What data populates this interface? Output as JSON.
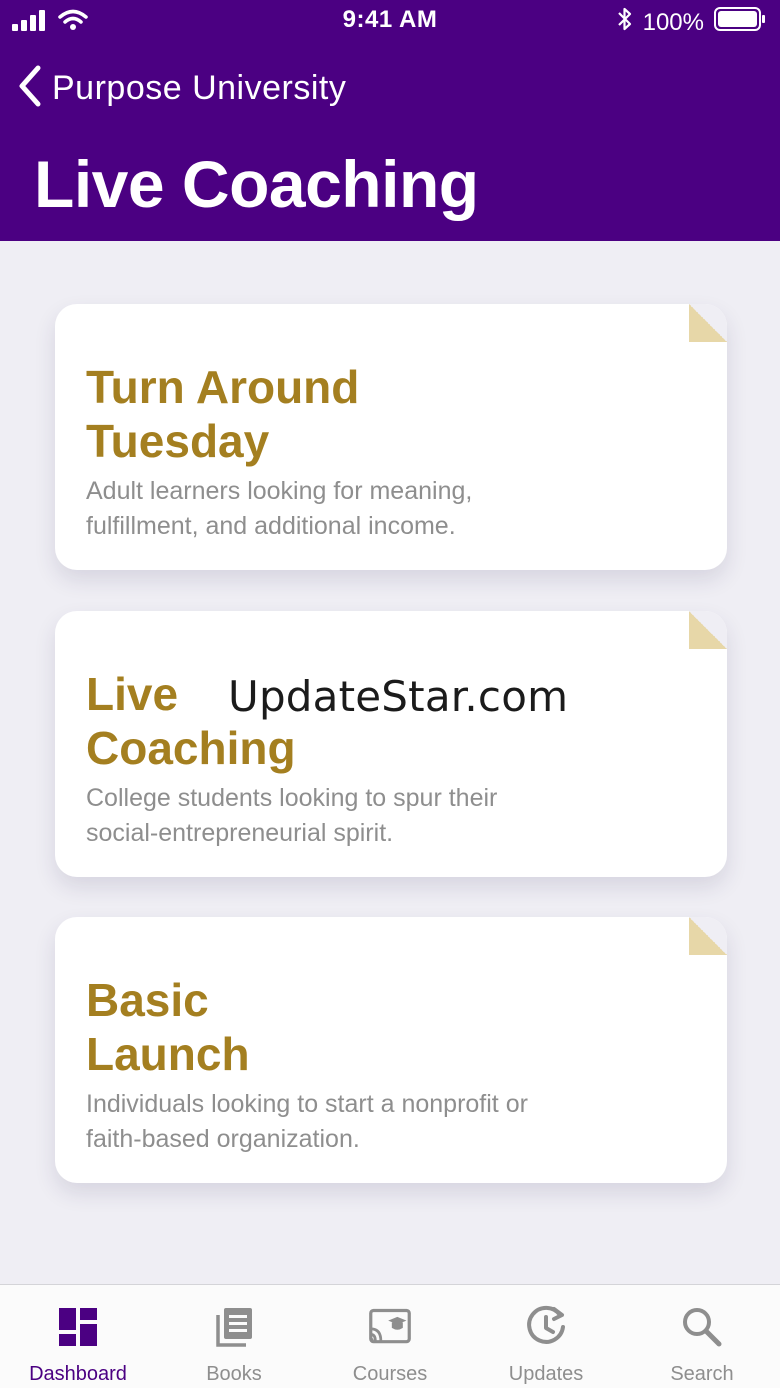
{
  "status_bar": {
    "time": "9:41 AM",
    "battery": "100%"
  },
  "nav": {
    "back_label": "Purpose University",
    "title": "Live Coaching"
  },
  "cards": [
    {
      "title_line1": "Turn Around",
      "title_line2": "Tuesday",
      "description": "Adult learners looking for meaning, fulfillment, and additional income."
    },
    {
      "title_line1": "Live",
      "title_line2": "Coaching",
      "description": "College students looking to spur their social-entrepreneurial spirit."
    },
    {
      "title_line1": "Basic",
      "title_line2": "Launch",
      "description": "Individuals looking to start a nonprofit or faith-based organization."
    }
  ],
  "watermark": "UpdateStar.com",
  "tabs": [
    {
      "label": "Dashboard",
      "icon": "dashboard-icon",
      "active": true
    },
    {
      "label": "Books",
      "icon": "books-icon",
      "active": false
    },
    {
      "label": "Courses",
      "icon": "courses-icon",
      "active": false
    },
    {
      "label": "Updates",
      "icon": "updates-icon",
      "active": false
    },
    {
      "label": "Search",
      "icon": "search-icon",
      "active": false
    }
  ],
  "colors": {
    "header": "#4b0082",
    "card_title": "#a47f20",
    "active_tab": "#4b0082",
    "inactive_tab": "#8e8e8e",
    "background": "#efeef4"
  }
}
